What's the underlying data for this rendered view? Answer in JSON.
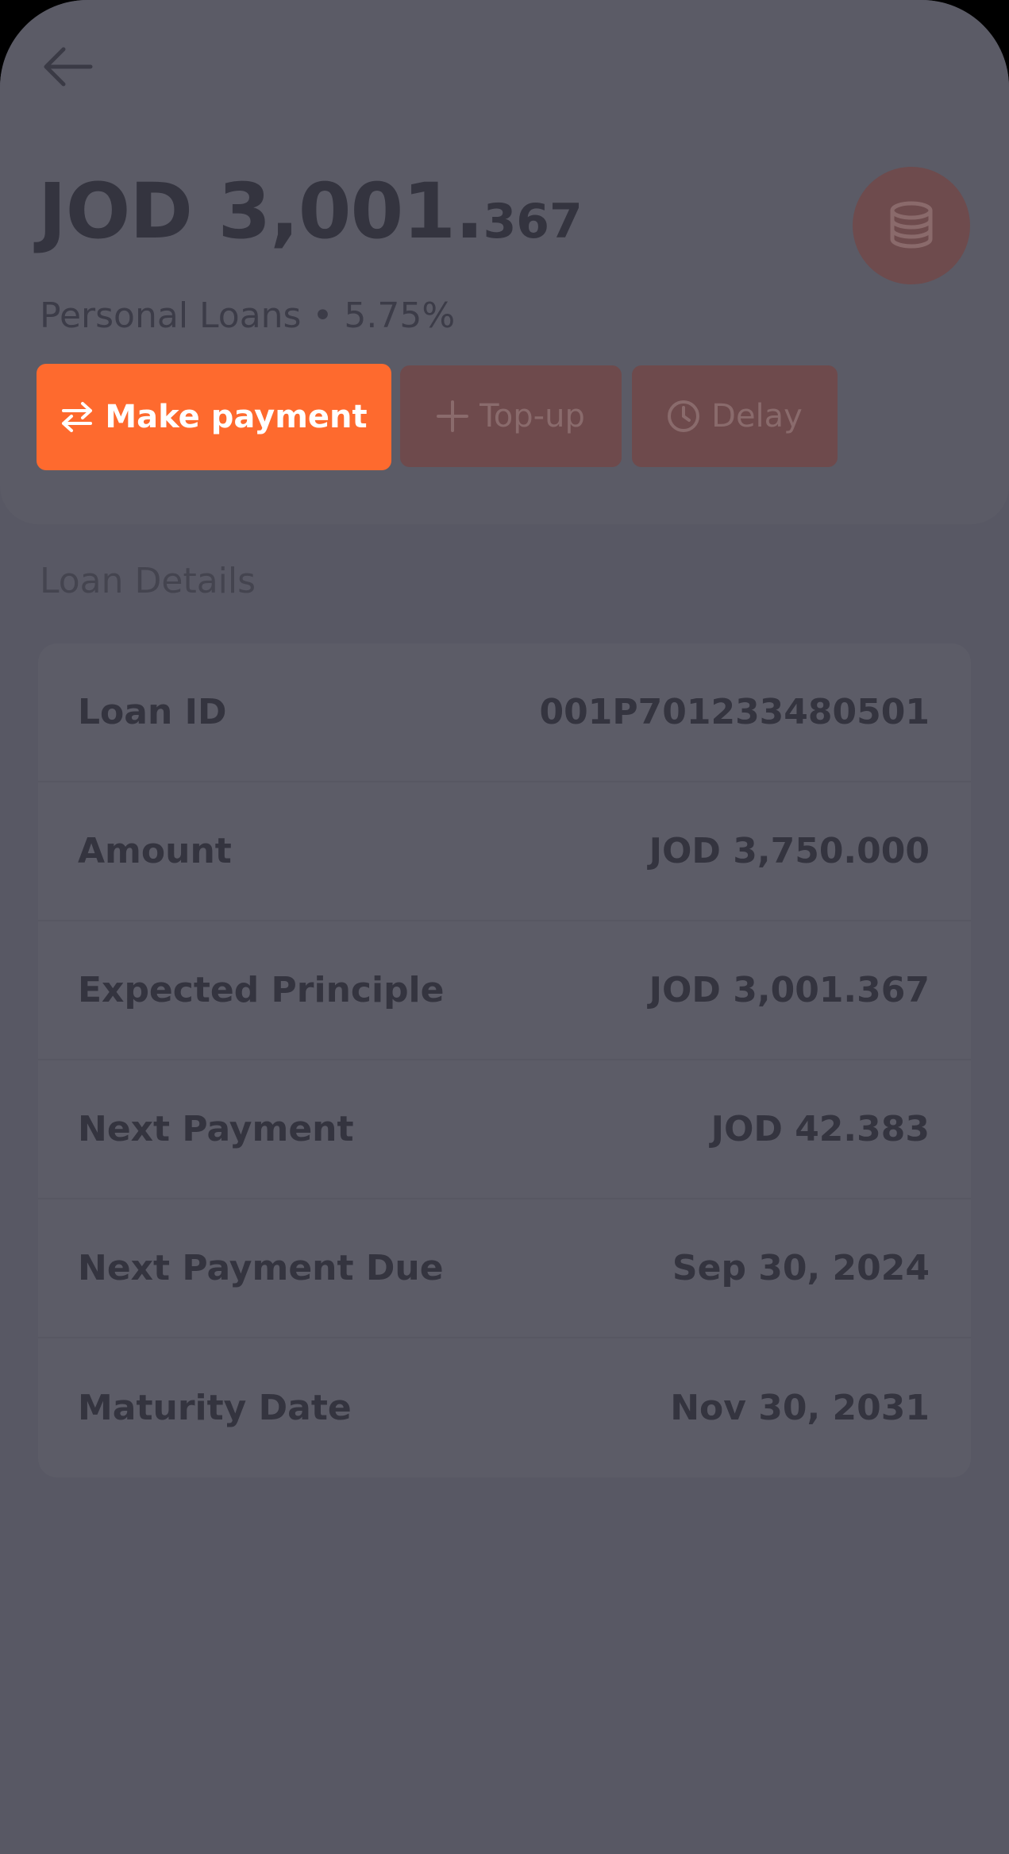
{
  "header": {
    "back_icon": "arrow-left-icon",
    "balance_major": "JOD 3,001.",
    "balance_minor": "367",
    "subtitle": "Personal Loans • 5.75%",
    "badge_icon": "coins-stack-icon"
  },
  "actions": {
    "make_payment": {
      "label": "Make payment",
      "icon": "swap-arrows-icon"
    },
    "top_up": {
      "label": "Top-up",
      "icon": "plus-icon"
    },
    "delay": {
      "label": "Delay",
      "icon": "clock-icon"
    }
  },
  "details": {
    "title": "Loan Details",
    "rows": [
      {
        "label": "Loan ID",
        "value": "001P701233480501"
      },
      {
        "label": "Amount",
        "value": "JOD 3,750.000"
      },
      {
        "label": "Expected Principle",
        "value": "JOD 3,001.367"
      },
      {
        "label": "Next Payment",
        "value": "JOD 42.383"
      },
      {
        "label": "Next Payment Due",
        "value": "Sep 30, 2024"
      },
      {
        "label": "Maturity Date",
        "value": "Nov 30, 2031"
      }
    ]
  },
  "colors": {
    "accent": "#fe6a2e",
    "overlay": "#585864",
    "muted_button": "#6e4a4c"
  }
}
